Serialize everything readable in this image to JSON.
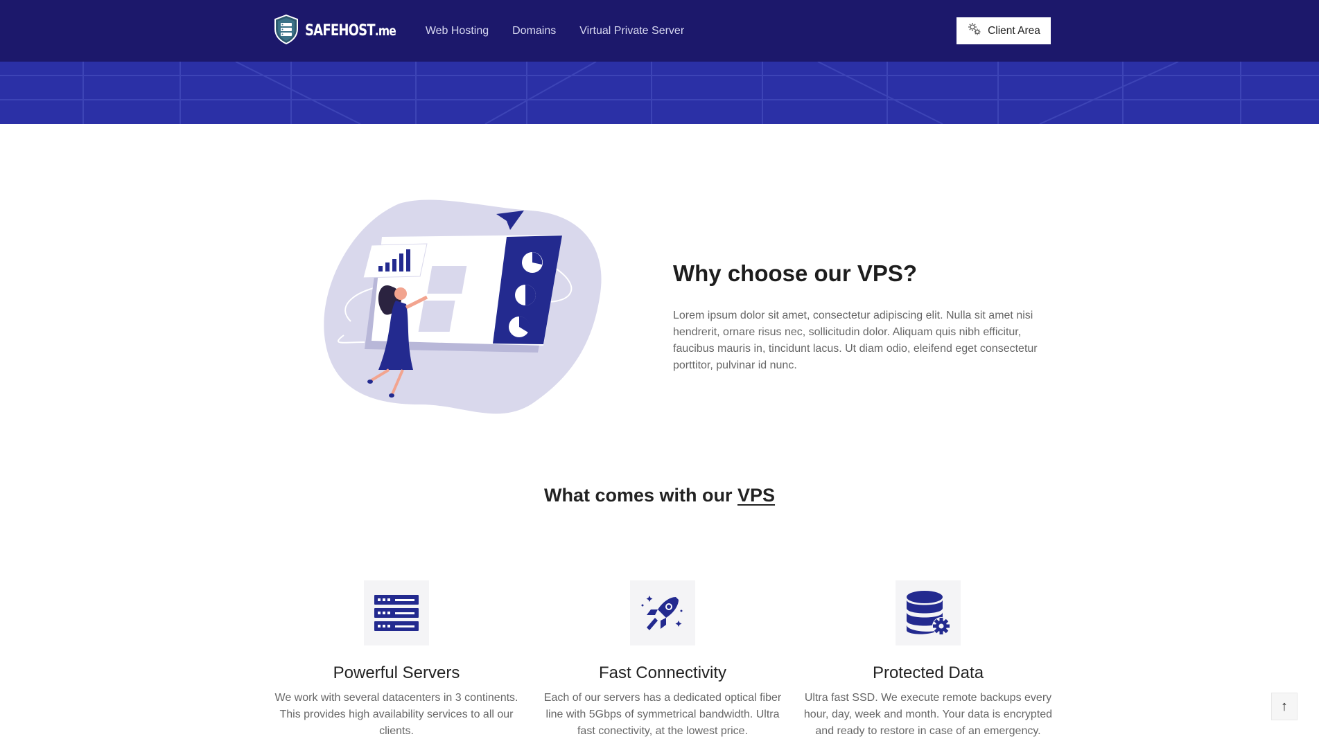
{
  "header": {
    "brand_name": "SAFEHOST",
    "brand_suffix": ".me",
    "nav": [
      {
        "label": "Web Hosting"
      },
      {
        "label": "Domains"
      },
      {
        "label": "Virtual Private Server"
      }
    ],
    "client_area_label": "Client Area",
    "client_area_icon": "gears-icon",
    "logo_icon": "shield-server-icon"
  },
  "colors": {
    "navbar": "#1c186b",
    "hero": "#2b30a6",
    "accent": "#232a8f",
    "illustration_blob": "#d9d8ec"
  },
  "why": {
    "title": "Why choose our VPS?",
    "text": "Lorem ipsum dolor sit amet, consectetur adipiscing elit. Nulla sit amet nisi hendrerit, ornare risus nec, sollicitudin dolor. Aliquam quis nibh efficitur, faucibus mauris in, tincidunt lacus. Ut diam odio, eleifend eget consectetur porttitor, pulvinar id nunc."
  },
  "features_heading": {
    "prefix": "What comes with our ",
    "highlight": "VPS"
  },
  "features": [
    {
      "icon": "server-rack-icon",
      "title": "Powerful Servers",
      "text": "We work with several datacenters in 3 continents. This provides high availability services to all our clients."
    },
    {
      "icon": "rocket-icon",
      "title": "Fast Connectivity",
      "text": "Each of our servers has a dedicated optical fiber line with 5Gbps of symmetrical bandwidth. Ultra fast conectivity, at the lowest price."
    },
    {
      "icon": "database-gear-icon",
      "title": "Protected Data",
      "text": "Ultra fast SSD. We execute remote backups every hour, day, week and month. Your data is encrypted and ready to restore in case of an emergency."
    }
  ],
  "scroll_top_label": "↑"
}
